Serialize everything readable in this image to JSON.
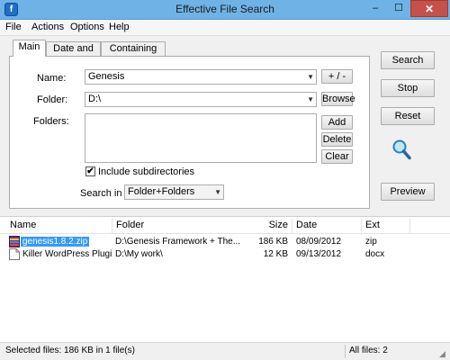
{
  "window": {
    "title": "Effective File Search",
    "app_icon_letter": "f",
    "minimize_symbol": "–",
    "maximize_symbol": "☐",
    "close_symbol": "✕"
  },
  "menu": [
    "File",
    "Actions",
    "Options",
    "Help"
  ],
  "tabs": [
    {
      "label": "Main",
      "active": true
    },
    {
      "label": "Date and size",
      "active": false
    },
    {
      "label": "Containing text",
      "active": false
    }
  ],
  "form": {
    "name_label": "Name:",
    "name_value": "Genesis",
    "plus_minus_label": "+ / -",
    "folder_label": "Folder:",
    "folder_value": "D:\\",
    "browse_label": "Browse",
    "folders_label": "Folders:",
    "add_label": "Add",
    "delete_label": "Delete",
    "clear_label": "Clear",
    "include_subdirs_label": "Include subdirectories",
    "include_subdirs_checked": "✔",
    "search_in_label": "Search in",
    "search_in_value": "Folder+Folders"
  },
  "actions": {
    "search_label": "Search",
    "stop_label": "Stop",
    "reset_label": "Reset",
    "preview_label": "Preview"
  },
  "results": {
    "columns": [
      "Name",
      "Folder",
      "Size",
      "Date",
      "Ext"
    ],
    "rows": [
      {
        "name": "genesis1.8.2.zip",
        "folder": "D:\\Genesis Framework + The...",
        "size": "186 KB",
        "date": "08/09/2012",
        "ext": "zip",
        "selected": true
      },
      {
        "name": "Killer WordPress Plugi...",
        "folder": "D:\\My work\\",
        "size": "12 KB",
        "date": "09/13/2012",
        "ext": "docx",
        "selected": false
      }
    ]
  },
  "status": {
    "selected": "Selected files: 186 KB in 1 file(s)",
    "all": "All files: 2"
  },
  "colors": {
    "titlebar": "#6fb3e6",
    "close_button": "#c7504a",
    "selection": "#3399ff"
  }
}
